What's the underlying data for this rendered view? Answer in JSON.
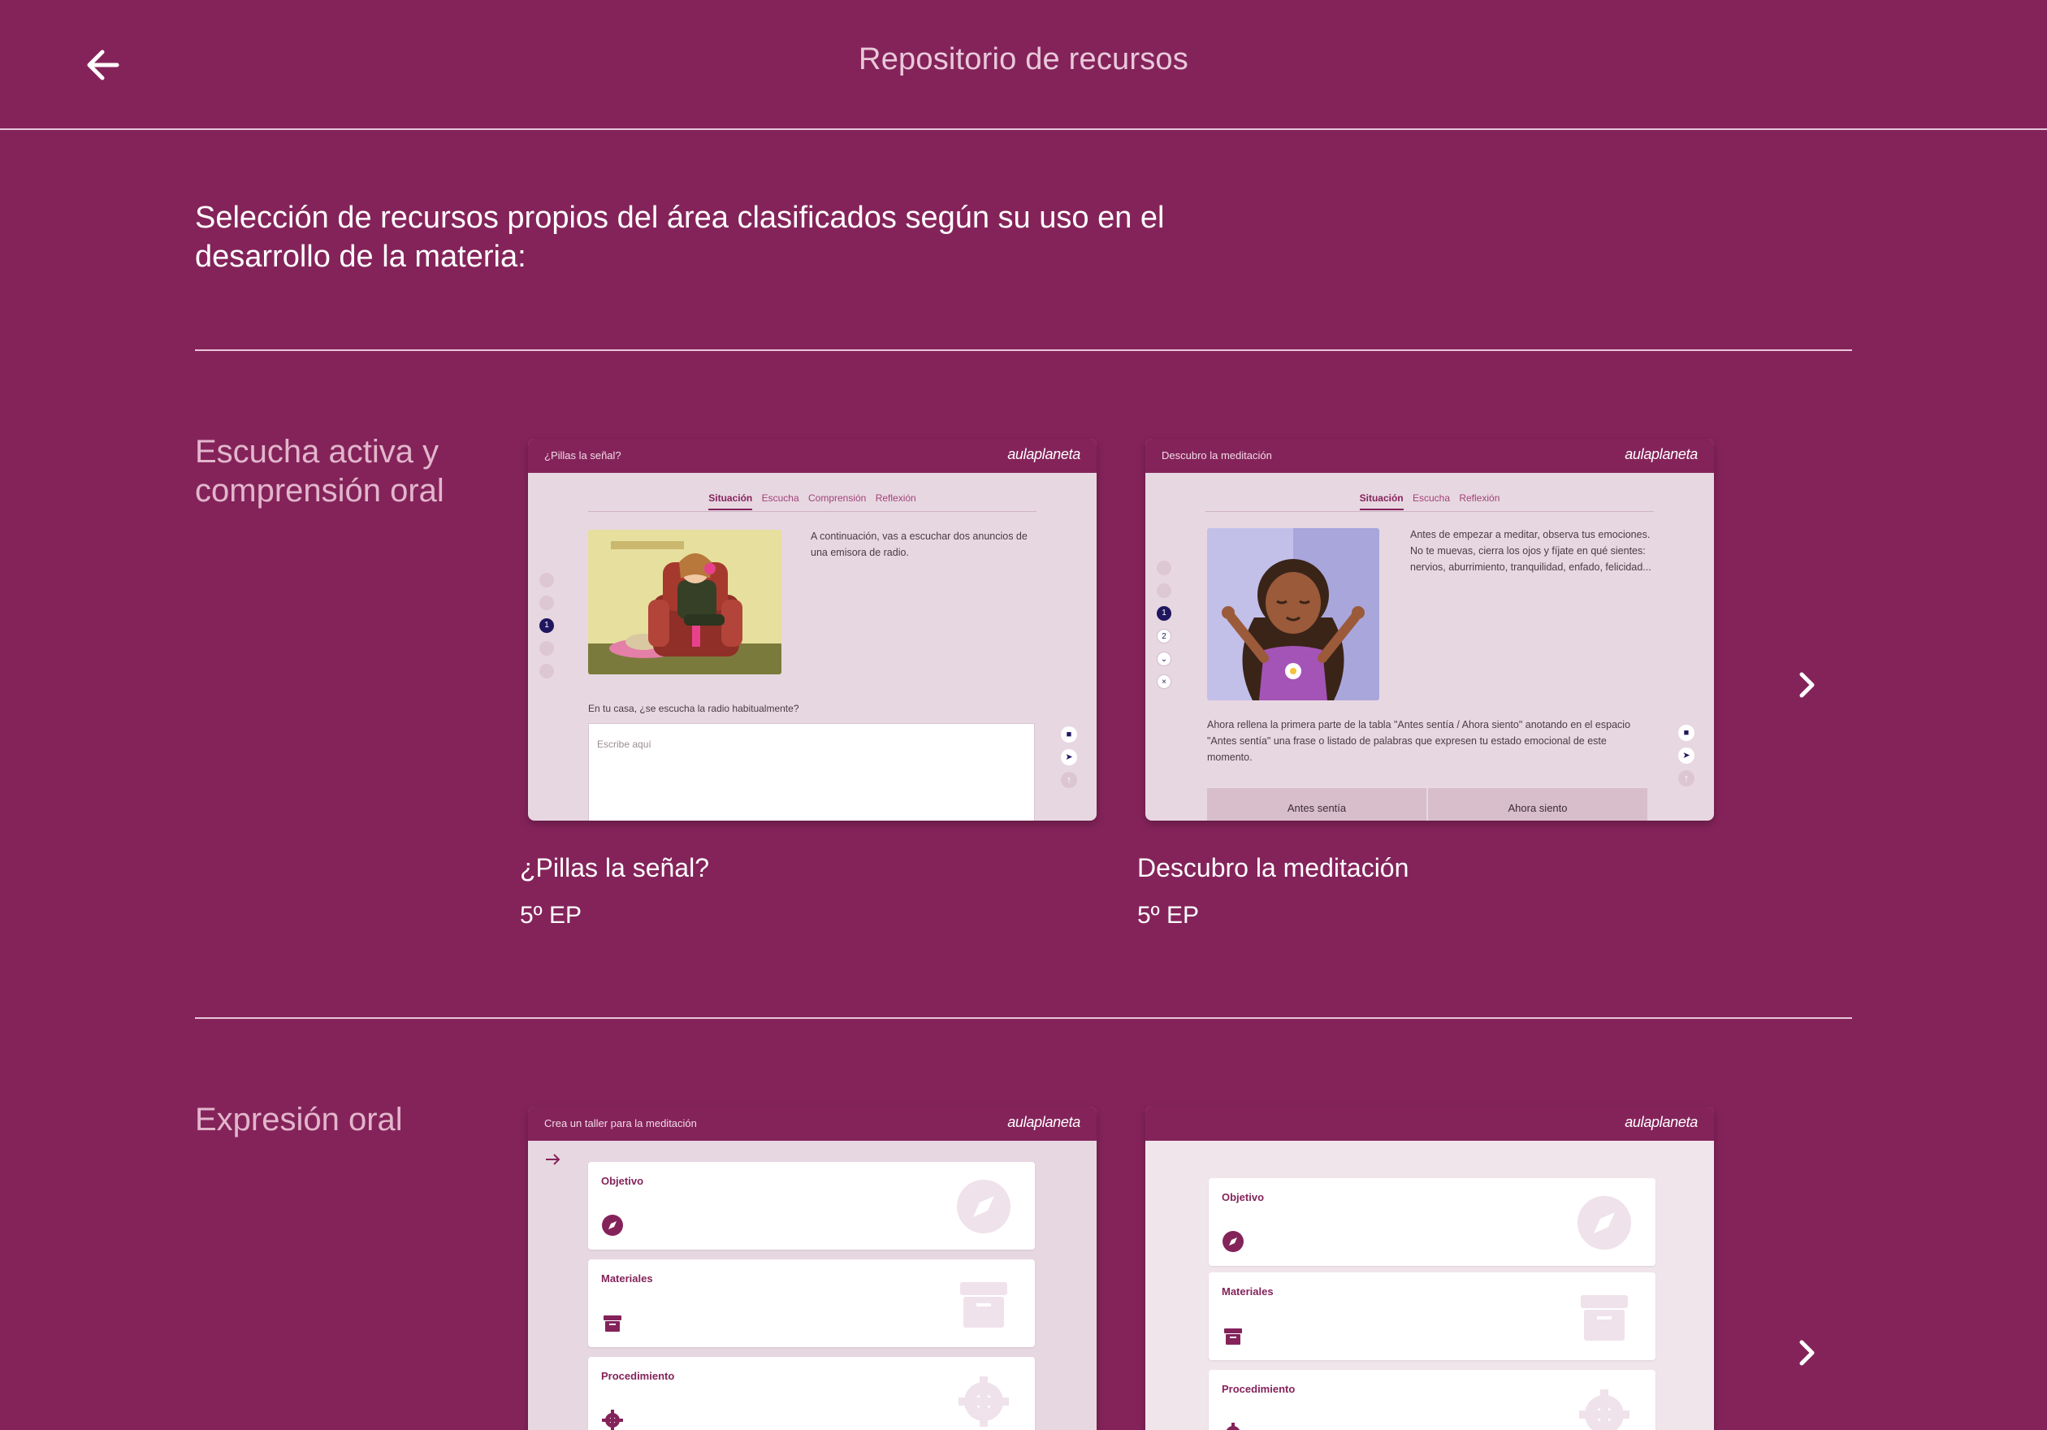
{
  "header": {
    "title": "Repositorio de recursos",
    "back_icon": "arrow-left-icon"
  },
  "intro": "Selección de recursos propios del área clasificados según su uso en el desarrollo de la materia:",
  "colors": {
    "background": "#84235a",
    "divider": "#e8c7d8",
    "section_title": "#e2b6cc"
  },
  "sections": [
    {
      "title": "Escucha activa y comprensión oral",
      "cards": [
        {
          "title": "¿Pillas la señal?",
          "grade": "5º EP",
          "thumb": {
            "bar_title": "¿Pillas la señal?",
            "logo": "aulaplaneta",
            "tabs": [
              "Situación",
              "Escucha",
              "Comprensión",
              "Reflexión"
            ],
            "text": "A continuación, vas a escuchar dos anuncios de una emisora de radio.",
            "question": "En tu casa, ¿se escucha la radio habitualmente?",
            "placeholder": "Escribe aquí",
            "step": "1"
          }
        },
        {
          "title": "Descubro la meditación",
          "grade": "5º EP",
          "thumb": {
            "bar_title": "Descubro la meditación",
            "logo": "aulaplaneta",
            "tabs": [
              "Situación",
              "Escucha",
              "Reflexión"
            ],
            "text": "Antes de empezar a meditar, observa tus emociones. No te muevas, cierra los ojos y fíjate en qué sientes: nervios, aburrimiento, tranquilidad, enfado, felicidad...",
            "instruction": "Ahora rellena la primera parte de la tabla \"Antes sentía / Ahora siento\" anotando en el espacio \"Antes sentía\" una frase o listado de palabras que expresen tu estado emocional de este momento.",
            "col1": "Antes sentía",
            "col2": "Ahora siento",
            "steps": [
              "1",
              "2"
            ]
          }
        }
      ]
    },
    {
      "title": "Expresión oral",
      "cards": [
        {
          "thumb": {
            "bar_title": "Crea un taller para la meditación",
            "logo": "aulaplaneta",
            "panels": [
              "Objetivo",
              "Materiales",
              "Procedimiento"
            ]
          }
        },
        {
          "thumb": {
            "bar_title": "",
            "logo": "aulaplaneta",
            "panels": [
              "Objetivo",
              "Materiales",
              "Procedimiento"
            ]
          }
        }
      ]
    }
  ]
}
